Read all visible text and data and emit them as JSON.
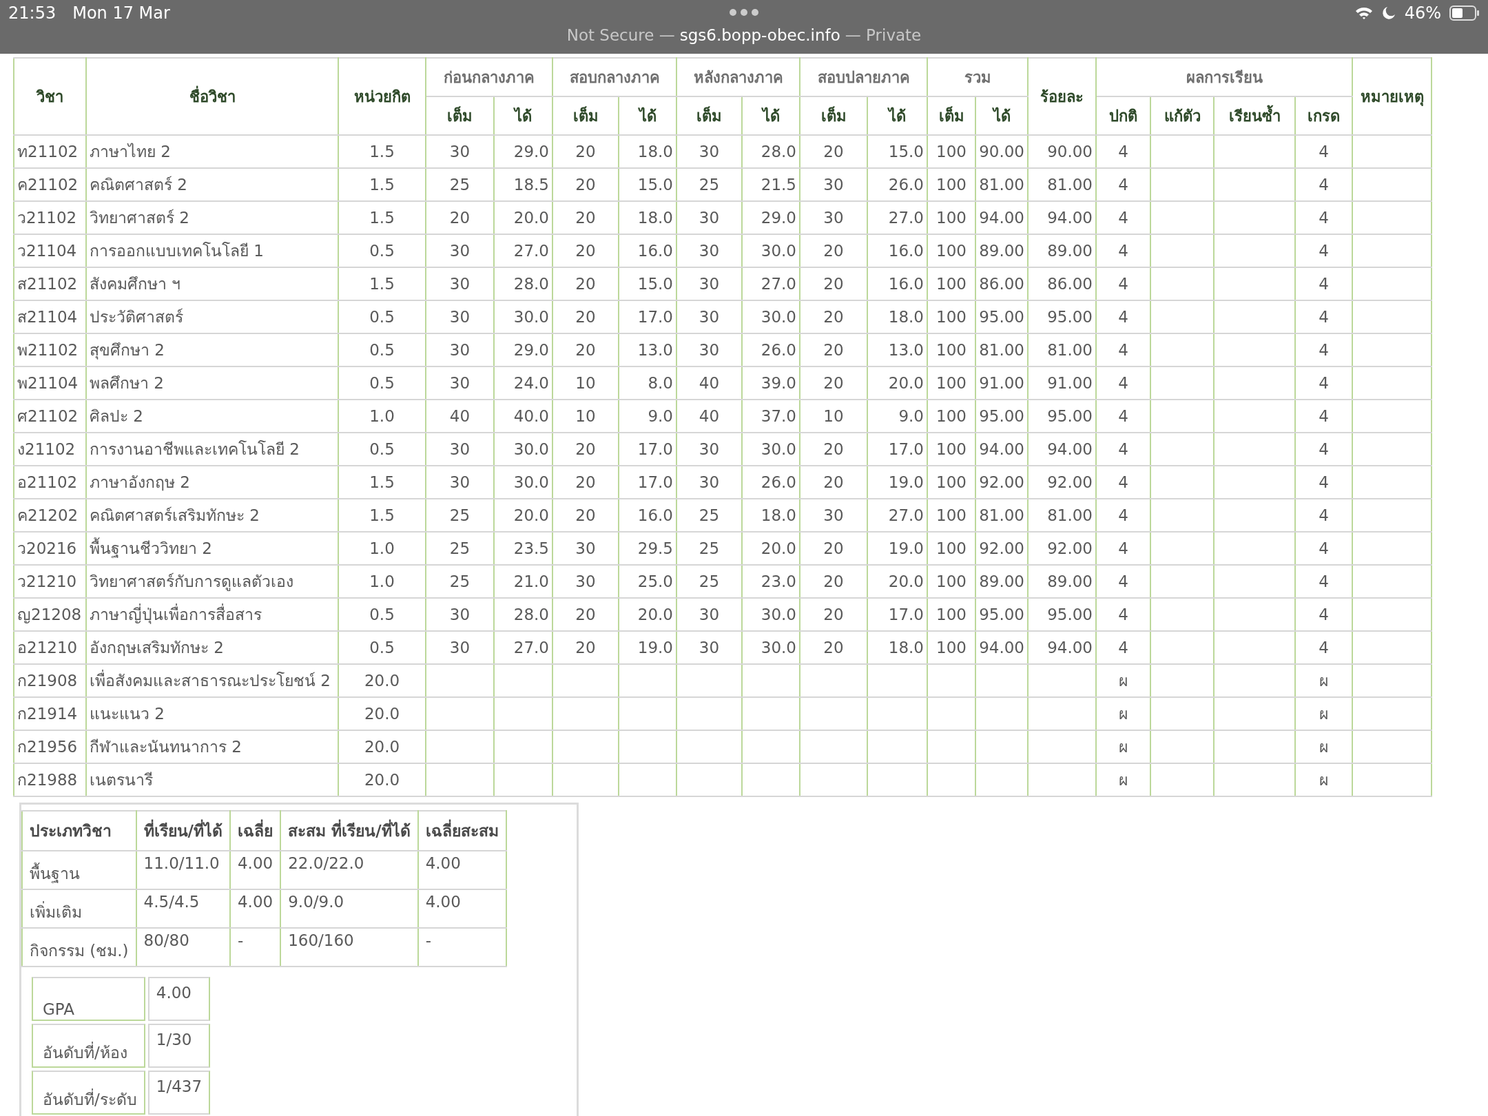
{
  "status_bar": {
    "time": "21:53",
    "date": "Mon 17 Mar",
    "battery": "46%"
  },
  "url_bar": {
    "security": "Not Secure —",
    "domain": "sgs6.bopp-obec.info",
    "mode": "— Private"
  },
  "grades_table": {
    "header": [
      {
        "label": "วิชา"
      },
      {
        "label": "ชื่อวิชา"
      },
      {
        "label": "หน่วยกิต"
      },
      {
        "label": "ก่อนกลางภาค",
        "sub": [
          "เต็ม",
          "ได้"
        ]
      },
      {
        "label": "สอบกลางภาค",
        "sub": [
          "เต็ม",
          "ได้"
        ]
      },
      {
        "label": "หลังกลางภาค",
        "sub": [
          "เต็ม",
          "ได้"
        ]
      },
      {
        "label": "สอบปลายภาค",
        "sub": [
          "เต็ม",
          "ได้"
        ]
      },
      {
        "label": "รวม",
        "sub": [
          "เต็ม",
          "ได้"
        ]
      },
      {
        "label": "ร้อยละ"
      },
      {
        "label": "ผลการเรียน",
        "sub": [
          "ปกติ",
          "แก้ตัว",
          "เรียนซ้ำ",
          "เกรด"
        ]
      },
      {
        "label": "หมายเหตุ"
      }
    ],
    "rows": [
      {
        "code": "ท21102",
        "name": "ภาษาไทย 2",
        "credit": "1.5",
        "scores": [
          "30",
          "29.0",
          "20",
          "18.0",
          "30",
          "28.0",
          "20",
          "15.0",
          "100",
          "90.00"
        ],
        "percent": "90.00",
        "normal": "4",
        "grade": "4"
      },
      {
        "code": "ค21102",
        "name": "คณิตศาสตร์ 2",
        "credit": "1.5",
        "scores": [
          "25",
          "18.5",
          "20",
          "15.0",
          "25",
          "21.5",
          "30",
          "26.0",
          "100",
          "81.00"
        ],
        "percent": "81.00",
        "normal": "4",
        "grade": "4"
      },
      {
        "code": "ว21102",
        "name": "วิทยาศาสตร์ 2",
        "credit": "1.5",
        "scores": [
          "20",
          "20.0",
          "20",
          "18.0",
          "30",
          "29.0",
          "30",
          "27.0",
          "100",
          "94.00"
        ],
        "percent": "94.00",
        "normal": "4",
        "grade": "4"
      },
      {
        "code": "ว21104",
        "name": "การออกแบบเทคโนโลยี 1",
        "credit": "0.5",
        "scores": [
          "30",
          "27.0",
          "20",
          "16.0",
          "30",
          "30.0",
          "20",
          "16.0",
          "100",
          "89.00"
        ],
        "percent": "89.00",
        "normal": "4",
        "grade": "4"
      },
      {
        "code": "ส21102",
        "name": "สังคมศึกษา ฯ",
        "credit": "1.5",
        "scores": [
          "30",
          "28.0",
          "20",
          "15.0",
          "30",
          "27.0",
          "20",
          "16.0",
          "100",
          "86.00"
        ],
        "percent": "86.00",
        "normal": "4",
        "grade": "4"
      },
      {
        "code": "ส21104",
        "name": "ประวัติศาสตร์",
        "credit": "0.5",
        "scores": [
          "30",
          "30.0",
          "20",
          "17.0",
          "30",
          "30.0",
          "20",
          "18.0",
          "100",
          "95.00"
        ],
        "percent": "95.00",
        "normal": "4",
        "grade": "4"
      },
      {
        "code": "พ21102",
        "name": "สุขศึกษา 2",
        "credit": "0.5",
        "scores": [
          "30",
          "29.0",
          "20",
          "13.0",
          "30",
          "26.0",
          "20",
          "13.0",
          "100",
          "81.00"
        ],
        "percent": "81.00",
        "normal": "4",
        "grade": "4"
      },
      {
        "code": "พ21104",
        "name": "พลศึกษา 2",
        "credit": "0.5",
        "scores": [
          "30",
          "24.0",
          "10",
          "8.0",
          "40",
          "39.0",
          "20",
          "20.0",
          "100",
          "91.00"
        ],
        "percent": "91.00",
        "normal": "4",
        "grade": "4"
      },
      {
        "code": "ศ21102",
        "name": "ศิลปะ 2",
        "credit": "1.0",
        "scores": [
          "40",
          "40.0",
          "10",
          "9.0",
          "40",
          "37.0",
          "10",
          "9.0",
          "100",
          "95.00"
        ],
        "percent": "95.00",
        "normal": "4",
        "grade": "4"
      },
      {
        "code": "ง21102",
        "name": "การงานอาชีพและเทคโนโลยี 2",
        "credit": "0.5",
        "scores": [
          "30",
          "30.0",
          "20",
          "17.0",
          "30",
          "30.0",
          "20",
          "17.0",
          "100",
          "94.00"
        ],
        "percent": "94.00",
        "normal": "4",
        "grade": "4"
      },
      {
        "code": "อ21102",
        "name": "ภาษาอังกฤษ 2",
        "credit": "1.5",
        "scores": [
          "30",
          "30.0",
          "20",
          "17.0",
          "30",
          "26.0",
          "20",
          "19.0",
          "100",
          "92.00"
        ],
        "percent": "92.00",
        "normal": "4",
        "grade": "4"
      },
      {
        "code": "ค21202",
        "name": "คณิตศาสตร์เสริมทักษะ 2",
        "credit": "1.5",
        "scores": [
          "25",
          "20.0",
          "20",
          "16.0",
          "25",
          "18.0",
          "30",
          "27.0",
          "100",
          "81.00"
        ],
        "percent": "81.00",
        "normal": "4",
        "grade": "4"
      },
      {
        "code": "ว20216",
        "name": "พื้นฐานชีววิทยา 2",
        "credit": "1.0",
        "scores": [
          "25",
          "23.5",
          "30",
          "29.5",
          "25",
          "20.0",
          "20",
          "19.0",
          "100",
          "92.00"
        ],
        "percent": "92.00",
        "normal": "4",
        "grade": "4"
      },
      {
        "code": "ว21210",
        "name": "วิทยาศาสตร์กับการดูแลตัวเอง",
        "credit": "1.0",
        "scores": [
          "25",
          "21.0",
          "30",
          "25.0",
          "25",
          "23.0",
          "20",
          "20.0",
          "100",
          "89.00"
        ],
        "percent": "89.00",
        "normal": "4",
        "grade": "4"
      },
      {
        "code": "ญ21208",
        "name": "ภาษาญี่ปุ่นเพื่อการสื่อสาร",
        "credit": "0.5",
        "scores": [
          "30",
          "28.0",
          "20",
          "20.0",
          "30",
          "30.0",
          "20",
          "17.0",
          "100",
          "95.00"
        ],
        "percent": "95.00",
        "normal": "4",
        "grade": "4"
      },
      {
        "code": "อ21210",
        "name": "อังกฤษเสริมทักษะ 2",
        "credit": "0.5",
        "scores": [
          "30",
          "27.0",
          "20",
          "19.0",
          "30",
          "30.0",
          "20",
          "18.0",
          "100",
          "94.00"
        ],
        "percent": "94.00",
        "normal": "4",
        "grade": "4"
      },
      {
        "code": "ก21908",
        "name": "เพื่อสังคมและสาธารณะประโยชน์ 2",
        "credit": "20.0",
        "normal": "ผ",
        "grade": "ผ"
      },
      {
        "code": "ก21914",
        "name": "แนะแนว 2",
        "credit": "20.0",
        "normal": "ผ",
        "grade": "ผ"
      },
      {
        "code": "ก21956",
        "name": "กีฬาและนันทนาการ 2",
        "credit": "20.0",
        "normal": "ผ",
        "grade": "ผ"
      },
      {
        "code": "ก21988",
        "name": "เนตรนารี",
        "credit": "20.0",
        "normal": "ผ",
        "grade": "ผ"
      }
    ]
  },
  "summary_table": {
    "columns": [
      "ประเภทวิชา",
      "ที่เรียน/ที่ได้",
      "เฉลี่ย",
      "สะสม ที่เรียน/ที่ได้",
      "เฉลี่ยสะสม"
    ],
    "rows": [
      [
        "พื้นฐาน",
        "11.0/11.0",
        "4.00",
        "22.0/22.0",
        "4.00"
      ],
      [
        "เพิ่มเติม",
        "4.5/4.5",
        "4.00",
        "9.0/9.0",
        "4.00"
      ],
      [
        "กิจกรรม (ชม.)",
        "80/80",
        "-",
        "160/160",
        "-"
      ]
    ]
  },
  "gpa_table": [
    {
      "label": "GPA",
      "value": "4.00"
    },
    {
      "label": "อันดับที่/ห้อง",
      "value": "1/30"
    },
    {
      "label": "อันดับที่/ระดับ",
      "value": "1/437"
    }
  ]
}
